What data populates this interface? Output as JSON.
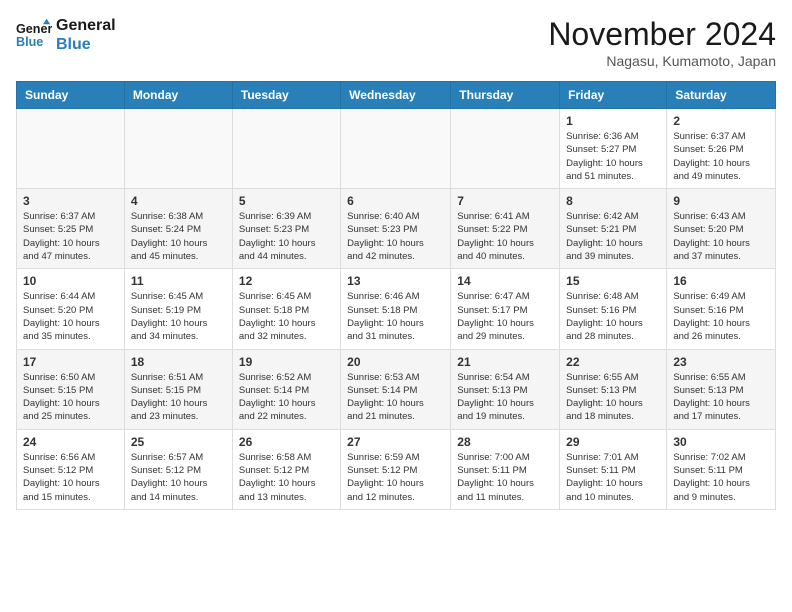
{
  "header": {
    "logo_line1": "General",
    "logo_line2": "Blue",
    "month": "November 2024",
    "location": "Nagasu, Kumamoto, Japan"
  },
  "weekdays": [
    "Sunday",
    "Monday",
    "Tuesday",
    "Wednesday",
    "Thursday",
    "Friday",
    "Saturday"
  ],
  "weeks": [
    [
      {
        "day": "",
        "info": ""
      },
      {
        "day": "",
        "info": ""
      },
      {
        "day": "",
        "info": ""
      },
      {
        "day": "",
        "info": ""
      },
      {
        "day": "",
        "info": ""
      },
      {
        "day": "1",
        "info": "Sunrise: 6:36 AM\nSunset: 5:27 PM\nDaylight: 10 hours\nand 51 minutes."
      },
      {
        "day": "2",
        "info": "Sunrise: 6:37 AM\nSunset: 5:26 PM\nDaylight: 10 hours\nand 49 minutes."
      }
    ],
    [
      {
        "day": "3",
        "info": "Sunrise: 6:37 AM\nSunset: 5:25 PM\nDaylight: 10 hours\nand 47 minutes."
      },
      {
        "day": "4",
        "info": "Sunrise: 6:38 AM\nSunset: 5:24 PM\nDaylight: 10 hours\nand 45 minutes."
      },
      {
        "day": "5",
        "info": "Sunrise: 6:39 AM\nSunset: 5:23 PM\nDaylight: 10 hours\nand 44 minutes."
      },
      {
        "day": "6",
        "info": "Sunrise: 6:40 AM\nSunset: 5:23 PM\nDaylight: 10 hours\nand 42 minutes."
      },
      {
        "day": "7",
        "info": "Sunrise: 6:41 AM\nSunset: 5:22 PM\nDaylight: 10 hours\nand 40 minutes."
      },
      {
        "day": "8",
        "info": "Sunrise: 6:42 AM\nSunset: 5:21 PM\nDaylight: 10 hours\nand 39 minutes."
      },
      {
        "day": "9",
        "info": "Sunrise: 6:43 AM\nSunset: 5:20 PM\nDaylight: 10 hours\nand 37 minutes."
      }
    ],
    [
      {
        "day": "10",
        "info": "Sunrise: 6:44 AM\nSunset: 5:20 PM\nDaylight: 10 hours\nand 35 minutes."
      },
      {
        "day": "11",
        "info": "Sunrise: 6:45 AM\nSunset: 5:19 PM\nDaylight: 10 hours\nand 34 minutes."
      },
      {
        "day": "12",
        "info": "Sunrise: 6:45 AM\nSunset: 5:18 PM\nDaylight: 10 hours\nand 32 minutes."
      },
      {
        "day": "13",
        "info": "Sunrise: 6:46 AM\nSunset: 5:18 PM\nDaylight: 10 hours\nand 31 minutes."
      },
      {
        "day": "14",
        "info": "Sunrise: 6:47 AM\nSunset: 5:17 PM\nDaylight: 10 hours\nand 29 minutes."
      },
      {
        "day": "15",
        "info": "Sunrise: 6:48 AM\nSunset: 5:16 PM\nDaylight: 10 hours\nand 28 minutes."
      },
      {
        "day": "16",
        "info": "Sunrise: 6:49 AM\nSunset: 5:16 PM\nDaylight: 10 hours\nand 26 minutes."
      }
    ],
    [
      {
        "day": "17",
        "info": "Sunrise: 6:50 AM\nSunset: 5:15 PM\nDaylight: 10 hours\nand 25 minutes."
      },
      {
        "day": "18",
        "info": "Sunrise: 6:51 AM\nSunset: 5:15 PM\nDaylight: 10 hours\nand 23 minutes."
      },
      {
        "day": "19",
        "info": "Sunrise: 6:52 AM\nSunset: 5:14 PM\nDaylight: 10 hours\nand 22 minutes."
      },
      {
        "day": "20",
        "info": "Sunrise: 6:53 AM\nSunset: 5:14 PM\nDaylight: 10 hours\nand 21 minutes."
      },
      {
        "day": "21",
        "info": "Sunrise: 6:54 AM\nSunset: 5:13 PM\nDaylight: 10 hours\nand 19 minutes."
      },
      {
        "day": "22",
        "info": "Sunrise: 6:55 AM\nSunset: 5:13 PM\nDaylight: 10 hours\nand 18 minutes."
      },
      {
        "day": "23",
        "info": "Sunrise: 6:55 AM\nSunset: 5:13 PM\nDaylight: 10 hours\nand 17 minutes."
      }
    ],
    [
      {
        "day": "24",
        "info": "Sunrise: 6:56 AM\nSunset: 5:12 PM\nDaylight: 10 hours\nand 15 minutes."
      },
      {
        "day": "25",
        "info": "Sunrise: 6:57 AM\nSunset: 5:12 PM\nDaylight: 10 hours\nand 14 minutes."
      },
      {
        "day": "26",
        "info": "Sunrise: 6:58 AM\nSunset: 5:12 PM\nDaylight: 10 hours\nand 13 minutes."
      },
      {
        "day": "27",
        "info": "Sunrise: 6:59 AM\nSunset: 5:12 PM\nDaylight: 10 hours\nand 12 minutes."
      },
      {
        "day": "28",
        "info": "Sunrise: 7:00 AM\nSunset: 5:11 PM\nDaylight: 10 hours\nand 11 minutes."
      },
      {
        "day": "29",
        "info": "Sunrise: 7:01 AM\nSunset: 5:11 PM\nDaylight: 10 hours\nand 10 minutes."
      },
      {
        "day": "30",
        "info": "Sunrise: 7:02 AM\nSunset: 5:11 PM\nDaylight: 10 hours\nand 9 minutes."
      }
    ]
  ]
}
